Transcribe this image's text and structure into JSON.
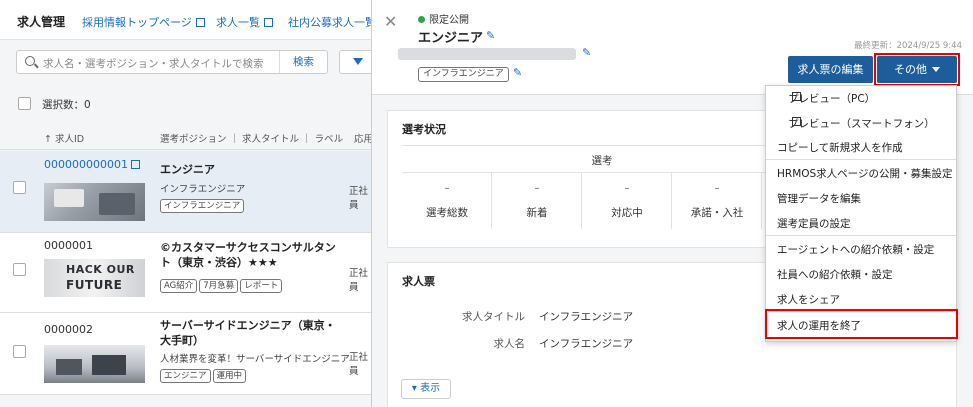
{
  "header": {
    "title": "求人管理",
    "nav": [
      "採用情報トップページ",
      "求人一覧",
      "社内公募求人一覧"
    ]
  },
  "search": {
    "placeholder": "求人名・選考ポジション・求人タイトルで検索",
    "button": "検索"
  },
  "selection": {
    "label": "選択数：0"
  },
  "columns": {
    "id": "↑ 求人ID",
    "position": "選考ポジション ｜ 求人タイトル ｜ ラベル",
    "other": "応用"
  },
  "rows": [
    {
      "id": "000000000001",
      "title": "エンジニア",
      "subtitle": "インフラエンジニア",
      "tags": [
        "インフラエンジニア"
      ],
      "col": "正社員"
    },
    {
      "id": "0000001",
      "title": "©カスタマーサクセスコンサルタント（東京・渋谷）★★★",
      "thumb_text": [
        "HACK OUR",
        "FUTURE"
      ],
      "tags": [
        "AG紹介",
        "7月急募",
        "レポート"
      ],
      "col": "正社員"
    },
    {
      "id": "0000002",
      "title": "サーバーサイドエンジニア（東京・大手町）",
      "subtitle": "人材業界を変革！サーバーサイドエンジニア",
      "tags": [
        "エンジニア",
        "運用中"
      ],
      "col": "正社員"
    }
  ],
  "drawer": {
    "status": "限定公開",
    "job_name": "エンジニア",
    "tag": "インフラエンジニア",
    "updated": "最終更新：2024/9/25 9:44",
    "edit_button": "求人票の編集",
    "more_button": "その他",
    "selection_title": "選考状況",
    "selection_header": "選考",
    "stats": [
      {
        "value": "–",
        "label": "選考総数"
      },
      {
        "value": "–",
        "label": "新着"
      },
      {
        "value": "–",
        "label": "対応中"
      },
      {
        "value": "–",
        "label": "承諾・入社"
      }
    ],
    "jobsheet_title": "求人票",
    "fields": [
      {
        "key": "求人タイトル",
        "value": "インフラエンジニア"
      },
      {
        "key": "求人名",
        "value": "インフラエンジニア"
      }
    ],
    "show_more": "▾ 表示"
  },
  "menu": {
    "items": [
      "プレビュー（PC）",
      "プレビュー（スマートフォン）",
      "コピーして新規求人を作成",
      "HRMOS求人ページの公開・募集設定",
      "管理データを編集",
      "選考定員の設定",
      "エージェントへの紹介依頼・設定",
      "社員への紹介依頼・設定",
      "求人をシェア",
      "求人の運用を終了"
    ]
  }
}
